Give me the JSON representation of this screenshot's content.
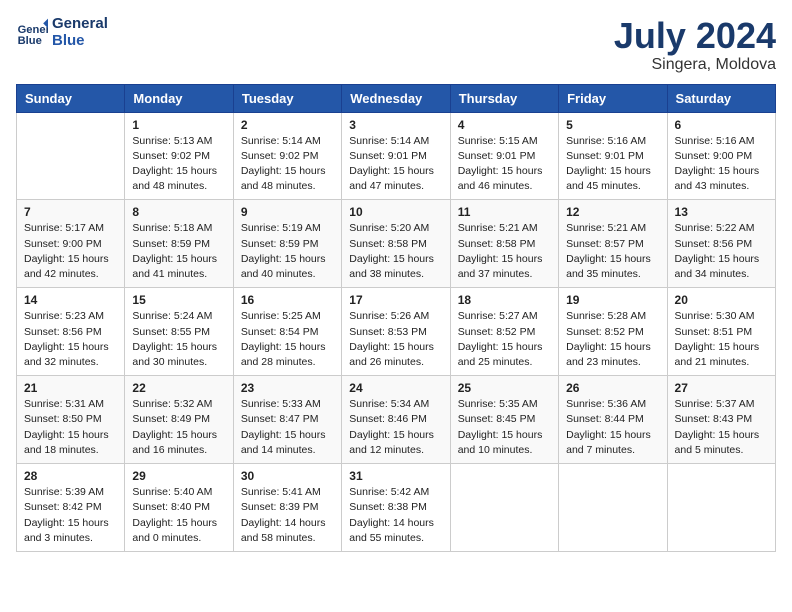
{
  "header": {
    "logo_line1": "General",
    "logo_line2": "Blue",
    "month_year": "July 2024",
    "location": "Singera, Moldova"
  },
  "weekdays": [
    "Sunday",
    "Monday",
    "Tuesday",
    "Wednesday",
    "Thursday",
    "Friday",
    "Saturday"
  ],
  "weeks": [
    [
      {
        "day": "",
        "info": ""
      },
      {
        "day": "1",
        "info": "Sunrise: 5:13 AM\nSunset: 9:02 PM\nDaylight: 15 hours\nand 48 minutes."
      },
      {
        "day": "2",
        "info": "Sunrise: 5:14 AM\nSunset: 9:02 PM\nDaylight: 15 hours\nand 48 minutes."
      },
      {
        "day": "3",
        "info": "Sunrise: 5:14 AM\nSunset: 9:01 PM\nDaylight: 15 hours\nand 47 minutes."
      },
      {
        "day": "4",
        "info": "Sunrise: 5:15 AM\nSunset: 9:01 PM\nDaylight: 15 hours\nand 46 minutes."
      },
      {
        "day": "5",
        "info": "Sunrise: 5:16 AM\nSunset: 9:01 PM\nDaylight: 15 hours\nand 45 minutes."
      },
      {
        "day": "6",
        "info": "Sunrise: 5:16 AM\nSunset: 9:00 PM\nDaylight: 15 hours\nand 43 minutes."
      }
    ],
    [
      {
        "day": "7",
        "info": "Sunrise: 5:17 AM\nSunset: 9:00 PM\nDaylight: 15 hours\nand 42 minutes."
      },
      {
        "day": "8",
        "info": "Sunrise: 5:18 AM\nSunset: 8:59 PM\nDaylight: 15 hours\nand 41 minutes."
      },
      {
        "day": "9",
        "info": "Sunrise: 5:19 AM\nSunset: 8:59 PM\nDaylight: 15 hours\nand 40 minutes."
      },
      {
        "day": "10",
        "info": "Sunrise: 5:20 AM\nSunset: 8:58 PM\nDaylight: 15 hours\nand 38 minutes."
      },
      {
        "day": "11",
        "info": "Sunrise: 5:21 AM\nSunset: 8:58 PM\nDaylight: 15 hours\nand 37 minutes."
      },
      {
        "day": "12",
        "info": "Sunrise: 5:21 AM\nSunset: 8:57 PM\nDaylight: 15 hours\nand 35 minutes."
      },
      {
        "day": "13",
        "info": "Sunrise: 5:22 AM\nSunset: 8:56 PM\nDaylight: 15 hours\nand 34 minutes."
      }
    ],
    [
      {
        "day": "14",
        "info": "Sunrise: 5:23 AM\nSunset: 8:56 PM\nDaylight: 15 hours\nand 32 minutes."
      },
      {
        "day": "15",
        "info": "Sunrise: 5:24 AM\nSunset: 8:55 PM\nDaylight: 15 hours\nand 30 minutes."
      },
      {
        "day": "16",
        "info": "Sunrise: 5:25 AM\nSunset: 8:54 PM\nDaylight: 15 hours\nand 28 minutes."
      },
      {
        "day": "17",
        "info": "Sunrise: 5:26 AM\nSunset: 8:53 PM\nDaylight: 15 hours\nand 26 minutes."
      },
      {
        "day": "18",
        "info": "Sunrise: 5:27 AM\nSunset: 8:52 PM\nDaylight: 15 hours\nand 25 minutes."
      },
      {
        "day": "19",
        "info": "Sunrise: 5:28 AM\nSunset: 8:52 PM\nDaylight: 15 hours\nand 23 minutes."
      },
      {
        "day": "20",
        "info": "Sunrise: 5:30 AM\nSunset: 8:51 PM\nDaylight: 15 hours\nand 21 minutes."
      }
    ],
    [
      {
        "day": "21",
        "info": "Sunrise: 5:31 AM\nSunset: 8:50 PM\nDaylight: 15 hours\nand 18 minutes."
      },
      {
        "day": "22",
        "info": "Sunrise: 5:32 AM\nSunset: 8:49 PM\nDaylight: 15 hours\nand 16 minutes."
      },
      {
        "day": "23",
        "info": "Sunrise: 5:33 AM\nSunset: 8:47 PM\nDaylight: 15 hours\nand 14 minutes."
      },
      {
        "day": "24",
        "info": "Sunrise: 5:34 AM\nSunset: 8:46 PM\nDaylight: 15 hours\nand 12 minutes."
      },
      {
        "day": "25",
        "info": "Sunrise: 5:35 AM\nSunset: 8:45 PM\nDaylight: 15 hours\nand 10 minutes."
      },
      {
        "day": "26",
        "info": "Sunrise: 5:36 AM\nSunset: 8:44 PM\nDaylight: 15 hours\nand 7 minutes."
      },
      {
        "day": "27",
        "info": "Sunrise: 5:37 AM\nSunset: 8:43 PM\nDaylight: 15 hours\nand 5 minutes."
      }
    ],
    [
      {
        "day": "28",
        "info": "Sunrise: 5:39 AM\nSunset: 8:42 PM\nDaylight: 15 hours\nand 3 minutes."
      },
      {
        "day": "29",
        "info": "Sunrise: 5:40 AM\nSunset: 8:40 PM\nDaylight: 15 hours\nand 0 minutes."
      },
      {
        "day": "30",
        "info": "Sunrise: 5:41 AM\nSunset: 8:39 PM\nDaylight: 14 hours\nand 58 minutes."
      },
      {
        "day": "31",
        "info": "Sunrise: 5:42 AM\nSunset: 8:38 PM\nDaylight: 14 hours\nand 55 minutes."
      },
      {
        "day": "",
        "info": ""
      },
      {
        "day": "",
        "info": ""
      },
      {
        "day": "",
        "info": ""
      }
    ]
  ]
}
